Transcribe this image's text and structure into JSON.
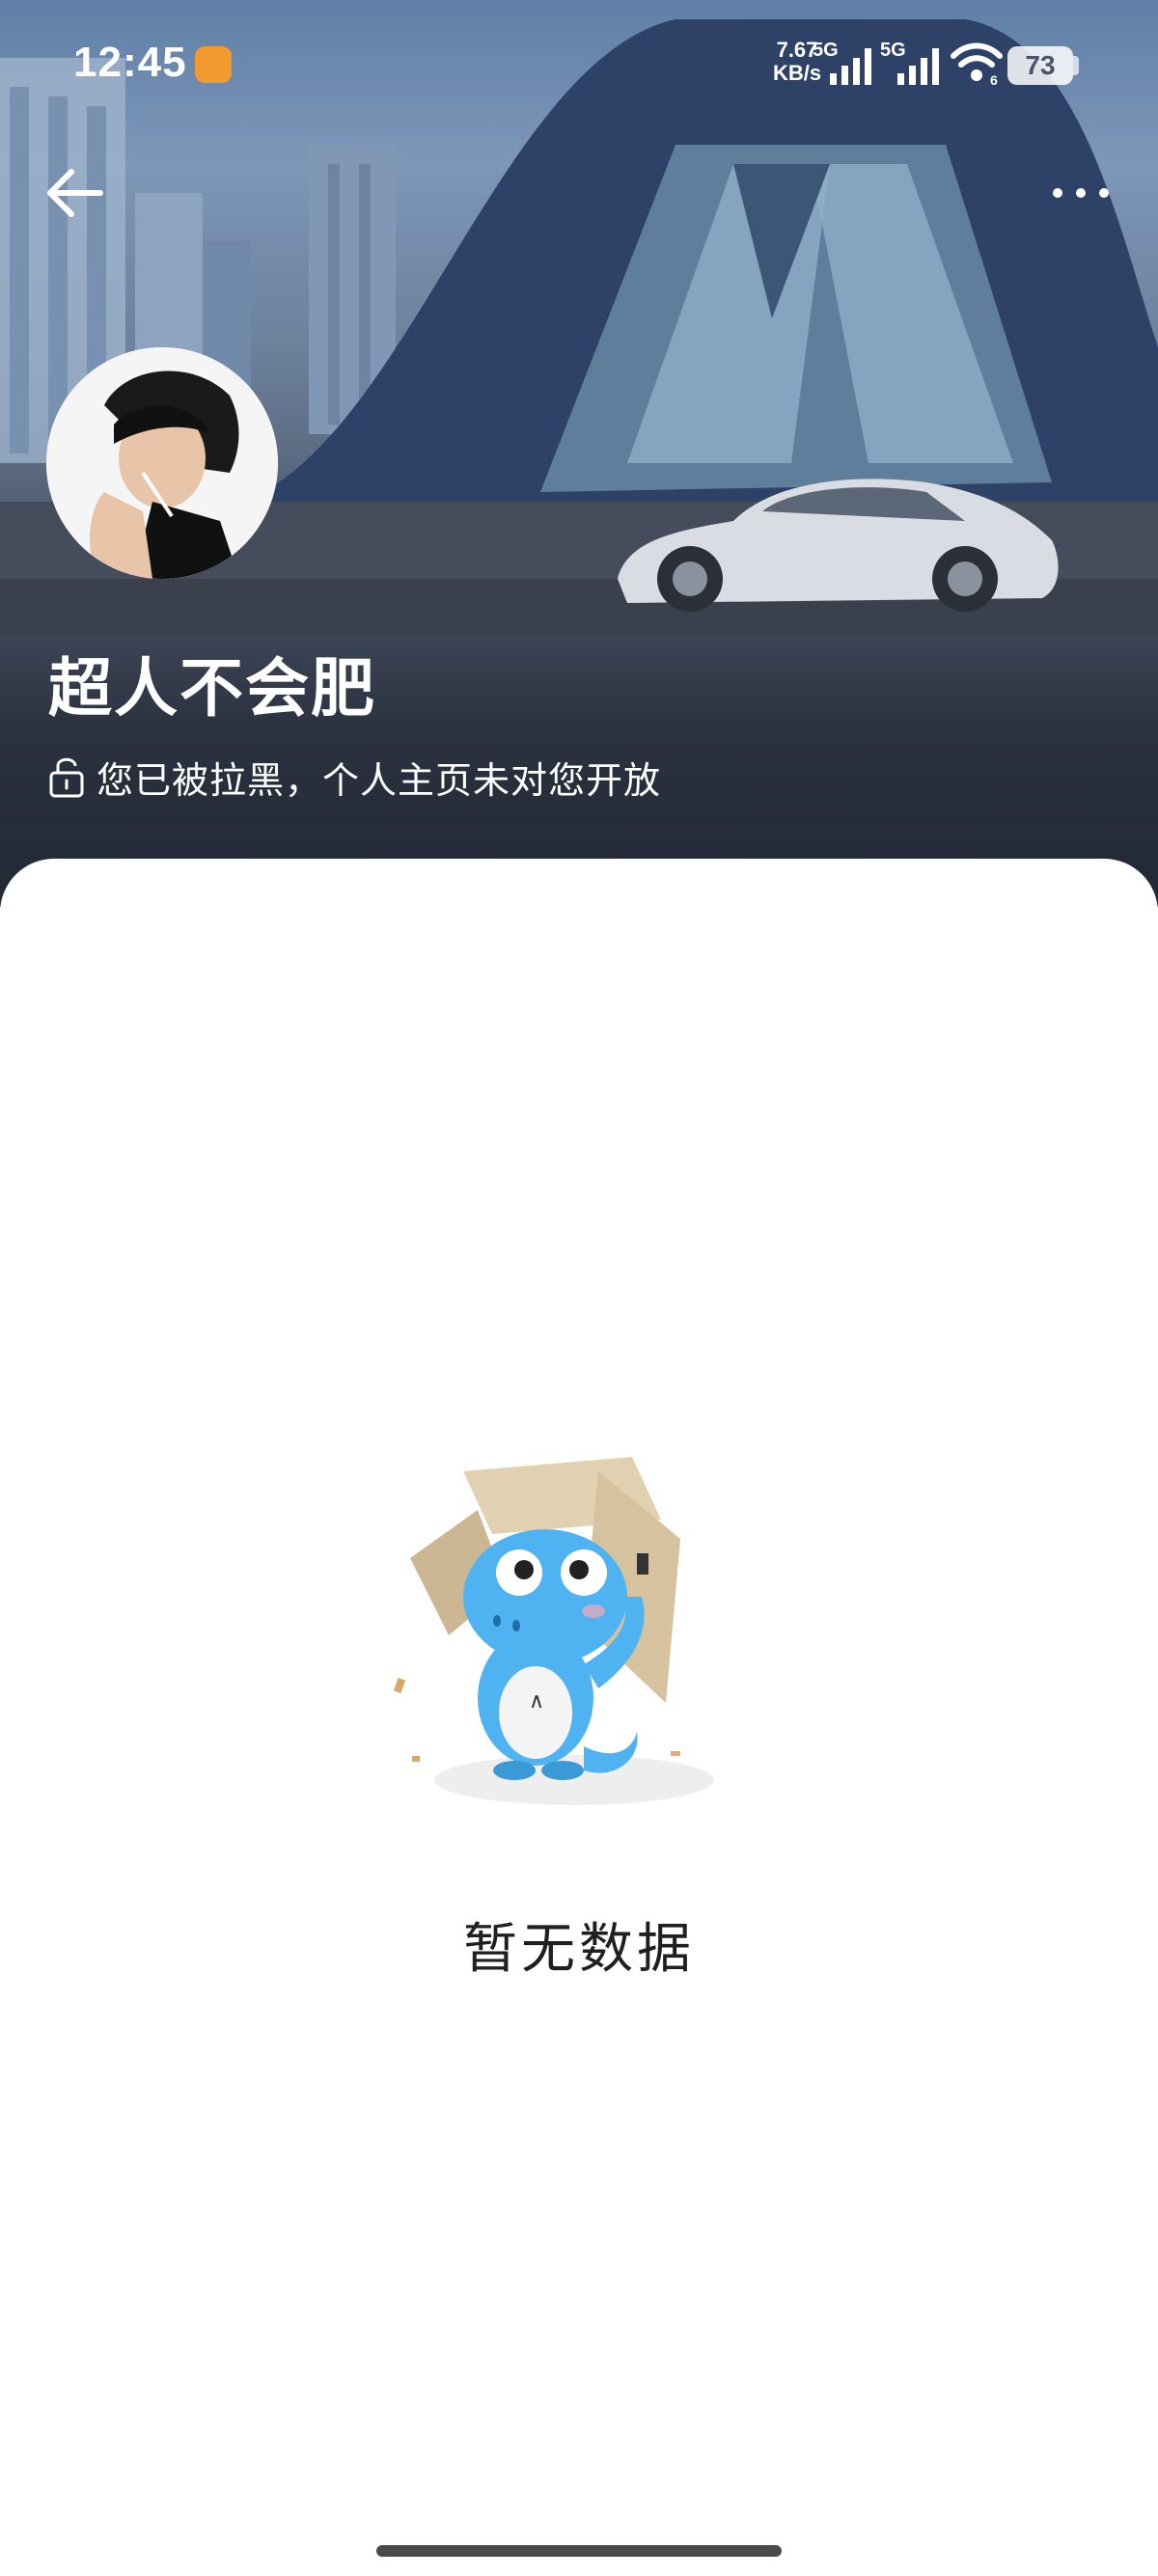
{
  "status_bar": {
    "time": "12:45",
    "net_speed_value": "7.67",
    "net_speed_unit": "KB/s",
    "signal_1_label": "5G",
    "signal_2_label": "5G",
    "wifi_badge": "6",
    "battery_level": "73"
  },
  "profile": {
    "username": "超人不会肥",
    "blocked_notice": "您已被拉黑，个人主页未对您开放"
  },
  "content": {
    "empty_text": "暂无数据"
  },
  "icons": {
    "back": "back-arrow-icon",
    "more": "more-dots-icon",
    "lock": "lock-icon"
  }
}
